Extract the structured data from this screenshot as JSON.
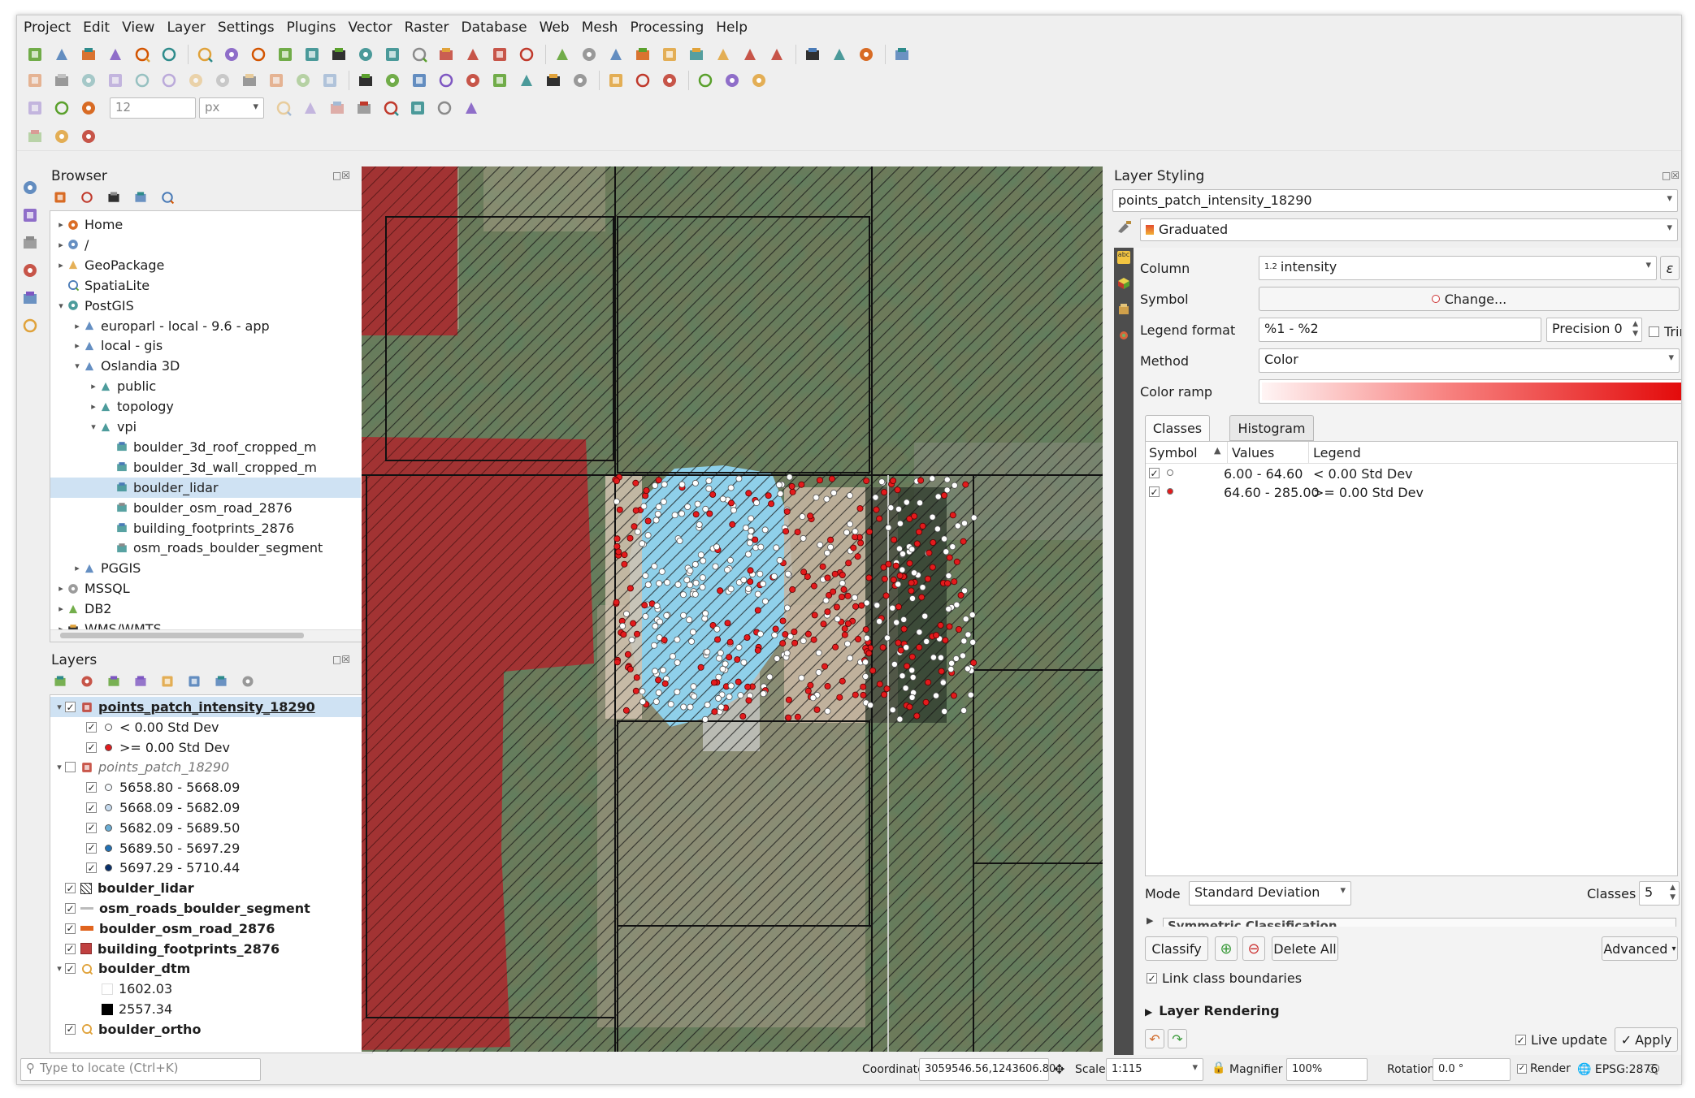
{
  "menu": [
    "Project",
    "Edit",
    "View",
    "Layer",
    "Settings",
    "Plugins",
    "Vector",
    "Raster",
    "Database",
    "Web",
    "Mesh",
    "Processing",
    "Help"
  ],
  "toolbar": {
    "snap_tolerance": "12",
    "snap_units": "px",
    "icons_row1": [
      "new-project-icon",
      "open-project-icon",
      "save-project-icon",
      "save-as-icon",
      "new-layout-icon",
      "style-manager-icon",
      "pan-icon",
      "pan-to-selection-icon",
      "zoom-in-icon",
      "zoom-out-icon",
      "zoom-full-icon",
      "zoom-to-selection-icon",
      "zoom-to-layer-icon",
      "zoom-native-icon",
      "zoom-last-icon",
      "zoom-next-icon",
      "new-map-view-icon",
      "new-bookmark-icon",
      "refresh-icon",
      "identify-icon",
      "run-action-icon",
      "select-features-icon",
      "select-by-value-icon",
      "deselect-icon",
      "attribute-table-icon",
      "field-calculator-icon",
      "toolbox-icon",
      "statistics-icon",
      "measure-icon",
      "map-tips-icon",
      "text-annotation-icon",
      "help-icon"
    ],
    "icons_row2": [
      "digitize-icon",
      "edit-pencil-icon",
      "save-edits-icon",
      "add-feature-icon",
      "vertex-tool-icon",
      "modify-attributes-icon",
      "delete-selected-icon",
      "cut-features-icon",
      "copy-features-icon",
      "paste-features-icon",
      "undo-icon",
      "redo-icon",
      "label-icon",
      "label-pin-icon",
      "label-show-icon",
      "label-move-icon",
      "diagram-icon",
      "label-rotate-icon",
      "label-change-icon",
      "label-toggle-icon",
      "label-layer-icon",
      "globe-icon",
      "globe-zoom-icon",
      "globe-settings-icon",
      "python-icon",
      "earth-icon",
      "terrain-icon"
    ],
    "icons_row3": [
      "magnet-icon",
      "snapping-icon",
      "snap-vertex-icon",
      "trace-icon",
      "split-icon",
      "reshape-icon",
      "offset-icon",
      "rotate-icon",
      "simplify-icon",
      "merge-icon",
      "fill-ring-icon"
    ],
    "icons_row4": [
      "plugin-icon",
      "metasearch-icon",
      "qgis3-icon"
    ]
  },
  "browser": {
    "title": "Browser",
    "items": [
      {
        "label": "Home",
        "icon": "home-icon",
        "arrow": "▸",
        "indent": 0
      },
      {
        "label": "/",
        "icon": "folder-icon",
        "arrow": "▸",
        "indent": 0
      },
      {
        "label": "GeoPackage",
        "icon": "geopackage-icon",
        "arrow": "▸",
        "indent": 0
      },
      {
        "label": "SpatiaLite",
        "icon": "spatialite-icon",
        "arrow": "",
        "indent": 0
      },
      {
        "label": "PostGIS",
        "icon": "postgis-icon",
        "arrow": "▾",
        "indent": 0
      },
      {
        "label": "europarl - local - 9.6 - app",
        "icon": "connection-icon",
        "arrow": "▸",
        "indent": 1
      },
      {
        "label": "local - gis",
        "icon": "connection-icon",
        "arrow": "▸",
        "indent": 1
      },
      {
        "label": "Oslandia 3D",
        "icon": "connection-icon",
        "arrow": "▾",
        "indent": 1
      },
      {
        "label": "public",
        "icon": "schema-icon",
        "arrow": "▸",
        "indent": 2
      },
      {
        "label": "topology",
        "icon": "schema-icon",
        "arrow": "▸",
        "indent": 2
      },
      {
        "label": "vpi",
        "icon": "schema-icon",
        "arrow": "▾",
        "indent": 2
      },
      {
        "label": "boulder_3d_roof_cropped_m",
        "icon": "polygon-layer-icon",
        "arrow": "",
        "indent": 3
      },
      {
        "label": "boulder_3d_wall_cropped_m",
        "icon": "polygon-layer-icon",
        "arrow": "",
        "indent": 3
      },
      {
        "label": "boulder_lidar",
        "icon": "polygon-layer-icon",
        "arrow": "",
        "indent": 3,
        "selected": true
      },
      {
        "label": "boulder_osm_road_2876",
        "icon": "line-layer-icon",
        "arrow": "",
        "indent": 3
      },
      {
        "label": "building_footprints_2876",
        "icon": "polygon-layer-icon",
        "arrow": "",
        "indent": 3
      },
      {
        "label": "osm_roads_boulder_segment",
        "icon": "line-layer-icon",
        "arrow": "",
        "indent": 3
      },
      {
        "label": "PGGIS",
        "icon": "connection-icon",
        "arrow": "▸",
        "indent": 1
      },
      {
        "label": "MSSQL",
        "icon": "mssql-icon",
        "arrow": "▸",
        "indent": 0
      },
      {
        "label": "DB2",
        "icon": "db2-icon",
        "arrow": "▸",
        "indent": 0
      },
      {
        "label": "WMS/WMTS",
        "icon": "wms-icon",
        "arrow": "▸",
        "indent": 0
      }
    ]
  },
  "layers": {
    "title": "Layers",
    "items": [
      {
        "label": "points_patch_intensity_18290",
        "style": "bold underline",
        "arrow": "▾",
        "check": true,
        "indent": 0,
        "icon": "points-icon",
        "selected": true
      },
      {
        "label": "< 0.00 Std Dev",
        "check": true,
        "indent": 1,
        "sym": "#ffffff"
      },
      {
        "label": ">= 0.00 Std Dev",
        "check": true,
        "indent": 1,
        "sym": "#e31a1c"
      },
      {
        "label": "points_patch_18290",
        "style": "ital",
        "arrow": "▾",
        "check": false,
        "indent": 0,
        "icon": "points-icon"
      },
      {
        "label": "5658.80 - 5668.09",
        "check": true,
        "indent": 1,
        "sym": "#f7fbff"
      },
      {
        "label": "5668.09 - 5682.09",
        "check": true,
        "indent": 1,
        "sym": "#c6dbef"
      },
      {
        "label": "5682.09 - 5689.50",
        "check": true,
        "indent": 1,
        "sym": "#6baed6"
      },
      {
        "label": "5689.50 - 5697.29",
        "check": true,
        "indent": 1,
        "sym": "#2171b5"
      },
      {
        "label": "5697.29 - 5710.44",
        "check": true,
        "indent": 1,
        "sym": "#08306b"
      },
      {
        "label": "boulder_lidar",
        "style": "bold",
        "check": true,
        "indent": 0,
        "swatch": "hatch"
      },
      {
        "label": "osm_roads_boulder_segment",
        "style": "bold",
        "check": true,
        "indent": 0,
        "swatch": "line"
      },
      {
        "label": "boulder_osm_road_2876",
        "style": "bold",
        "check": true,
        "indent": 0,
        "swatch": "road"
      },
      {
        "label": "building_footprints_2876",
        "style": "bold",
        "check": true,
        "indent": 0,
        "swatch": "red"
      },
      {
        "label": "boulder_dtm",
        "style": "bold",
        "arrow": "▾",
        "check": true,
        "indent": 0,
        "icon": "raster-icon"
      },
      {
        "label": "1602.03",
        "indent": 1,
        "swatch": "white"
      },
      {
        "label": "2557.34",
        "indent": 1,
        "swatch": "black"
      },
      {
        "label": "boulder_ortho",
        "style": "bold",
        "check": true,
        "indent": 0,
        "icon": "raster-icon"
      }
    ]
  },
  "styling": {
    "title": "Layer Styling",
    "layer": "points_patch_intensity_18290",
    "renderer": "Graduated",
    "column_label": "Column",
    "column": "intensity",
    "column_type": "1.2",
    "symbol_label": "Symbol",
    "symbol_button": "Change...",
    "legend_format_label": "Legend format",
    "legend_format": "%1 - %2",
    "precision_label": "Precision",
    "precision": "0",
    "trim": "Trim",
    "method_label": "Method",
    "method": "Color",
    "ramp_label": "Color ramp",
    "tabs": [
      "Classes",
      "Histogram"
    ],
    "table_headers": [
      "Symbol",
      "Values",
      "Legend"
    ],
    "classes": [
      {
        "color": "#ffffff",
        "values": "6.00 - 64.60",
        "legend": "< 0.00 Std Dev"
      },
      {
        "color": "#e31a1c",
        "values": "64.60 - 285.00",
        "legend": ">= 0.00 Std Dev"
      }
    ],
    "mode_label": "Mode",
    "mode": "Standard Deviation",
    "classes_label": "Classes",
    "classes_count": "5",
    "symmetric": "Symmetric Classification",
    "classify": "Classify",
    "delete_all": "Delete All",
    "advanced": "Advanced",
    "link_boundaries": "Link class boundaries",
    "layer_rendering": "Layer Rendering",
    "live_update": "Live update",
    "apply": "Apply"
  },
  "status": {
    "locate_placeholder": "Type to locate (Ctrl+K)",
    "coordinate_label": "Coordinate",
    "coordinate": "3059546.56,1243606.80",
    "scale_label": "Scale",
    "scale": "1:115",
    "magnifier_label": "Magnifier",
    "magnifier": "100%",
    "rotation_label": "Rotation",
    "rotation": "0.0 °",
    "render": "Render",
    "crs": "EPSG:2876"
  },
  "colors": {
    "accent": "#cfe2f3",
    "building": "#a63232",
    "points_red": "#e31a1c",
    "pool": "#8fd0ea"
  }
}
